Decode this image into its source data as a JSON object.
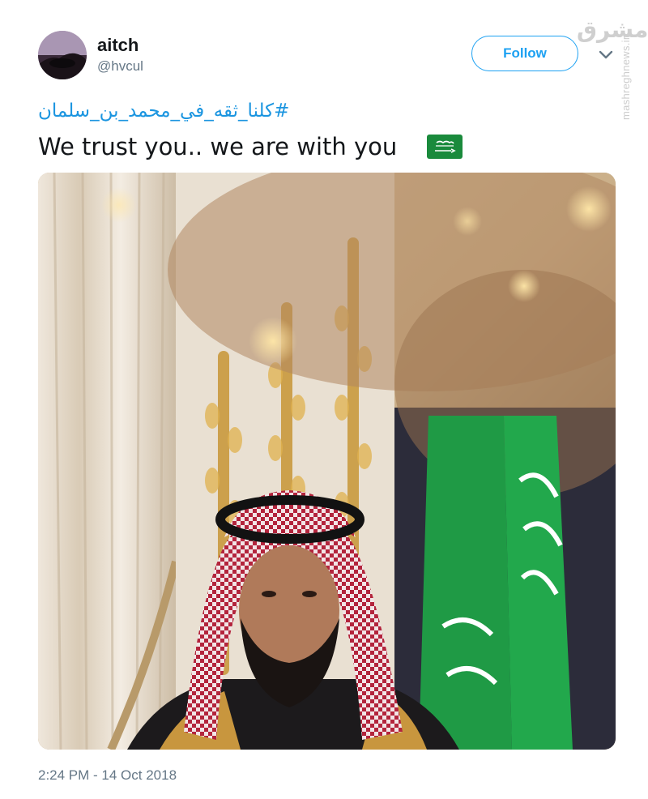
{
  "user": {
    "display_name": "aitch",
    "handle": "@hvcul"
  },
  "follow_label": "Follow",
  "tweet": {
    "hashtag": "#كلنا_ثقه_في_محمد_بن_سلمان",
    "text": "We trust you.. we are with you",
    "emoji": "saudi-arabia-flag",
    "timestamp": "2:24 PM - 14 Oct 2018"
  },
  "watermark": {
    "logo": "مشرق",
    "site": "mashreghnews.ir"
  },
  "colors": {
    "accent": "#1da1f2",
    "hashtag": "#1b95e0",
    "text": "#14171a",
    "muted": "#657786",
    "flag_green": "#1a8a3c"
  }
}
